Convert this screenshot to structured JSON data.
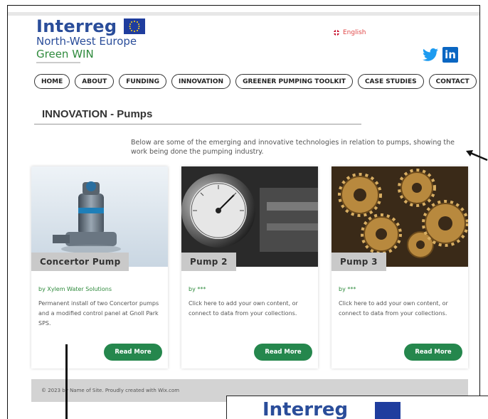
{
  "logo": {
    "brand": "Interreg",
    "region": "North-West Europe",
    "program": "Green WIN"
  },
  "language": "English",
  "nav": [
    "HOME",
    "ABOUT",
    "FUNDING",
    "INNOVATION",
    "GREENER PUMPING TOOLKIT",
    "CASE STUDIES",
    "CONTACT"
  ],
  "page_title": "INNOVATION - Pumps",
  "intro": "Below are some of the emerging and innovative technologies in relation to pumps, showing the work being done the pumping industry.",
  "cards": [
    {
      "title": "Concertor Pump",
      "author": "by Xylem Water Solutions",
      "desc": "Permanent install of two Concertor pumps and a modified control panel at Gnoll Park SPS.",
      "button": "Read More",
      "image": "submersible-pump-photo"
    },
    {
      "title": "Pump 2",
      "author": "by ***",
      "desc": "Click here to add your own content, or connect to data from your collections.",
      "button": "Read More",
      "image": "pressure-gauge-photo"
    },
    {
      "title": "Pump 3",
      "author": "by ***",
      "desc": "Click here to add your own content, or connect to data from your collections.",
      "button": "Read More",
      "image": "brass-gears-photo"
    }
  ],
  "footer": "© 2023 by Name of Site. Proudly created with Wix.com",
  "overlay_brand": "Interreg",
  "colors": {
    "brand_blue": "#2a4d9a",
    "brand_green": "#2e8a3c",
    "button_green": "#25874d",
    "lang_red": "#e04848"
  }
}
